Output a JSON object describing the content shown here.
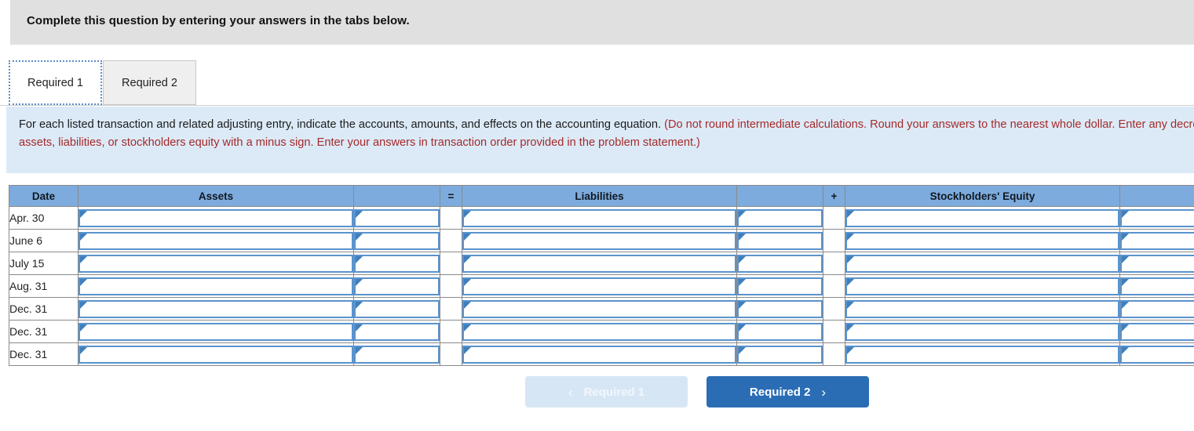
{
  "banner": {
    "title": "Complete this question by entering your answers in the tabs below."
  },
  "tabs": [
    {
      "label": "Required 1",
      "active": true
    },
    {
      "label": "Required 2",
      "active": false
    }
  ],
  "instructions": {
    "lead": "For each listed transaction and related adjusting entry, indicate the accounts, amounts, and effects on the accounting equation. ",
    "note": "(Do not round intermediate calculations. Round your answers to the nearest whole dollar. Enter any decreases to assets, liabilities, or stockholders equity with a minus sign. Enter your answers in transaction order provided in the problem statement.)",
    "note_color": "#a52a2a",
    "background_color": "#dceaf7"
  },
  "table": {
    "header_color": "#7dabdd",
    "columns": [
      {
        "key": "date",
        "label": "Date"
      },
      {
        "key": "assets_account",
        "label": "Assets"
      },
      {
        "key": "assets_amount",
        "label": ""
      },
      {
        "key": "equals",
        "label": "="
      },
      {
        "key": "liabilities_account",
        "label": "Liabilities"
      },
      {
        "key": "liabilities_amount",
        "label": ""
      },
      {
        "key": "plus",
        "label": "+"
      },
      {
        "key": "equity_account",
        "label": "Stockholders' Equity"
      },
      {
        "key": "equity_amount",
        "label": ""
      }
    ],
    "rows": [
      {
        "date": "Apr. 30",
        "assets_account": "",
        "assets_amount": "",
        "liabilities_account": "",
        "liabilities_amount": "",
        "equity_account": "",
        "equity_amount": ""
      },
      {
        "date": "June 6",
        "assets_account": "",
        "assets_amount": "",
        "liabilities_account": "",
        "liabilities_amount": "",
        "equity_account": "",
        "equity_amount": ""
      },
      {
        "date": "July 15",
        "assets_account": "",
        "assets_amount": "",
        "liabilities_account": "",
        "liabilities_amount": "",
        "equity_account": "",
        "equity_amount": ""
      },
      {
        "date": "Aug. 31",
        "assets_account": "",
        "assets_amount": "",
        "liabilities_account": "",
        "liabilities_amount": "",
        "equity_account": "",
        "equity_amount": ""
      },
      {
        "date": "Dec. 31",
        "assets_account": "",
        "assets_amount": "",
        "liabilities_account": "",
        "liabilities_amount": "",
        "equity_account": "",
        "equity_amount": ""
      },
      {
        "date": "Dec. 31",
        "assets_account": "",
        "assets_amount": "",
        "liabilities_account": "",
        "liabilities_amount": "",
        "equity_account": "",
        "equity_amount": ""
      },
      {
        "date": "Dec. 31",
        "assets_account": "",
        "assets_amount": "",
        "liabilities_account": "",
        "liabilities_amount": "",
        "equity_account": "",
        "equity_amount": ""
      }
    ]
  },
  "navigation": {
    "prev_label": "Required 1",
    "prev_chevron": "‹",
    "prev_disabled": true,
    "next_label": "Required 2",
    "next_chevron": "›",
    "next_color": "#2a6db5"
  }
}
